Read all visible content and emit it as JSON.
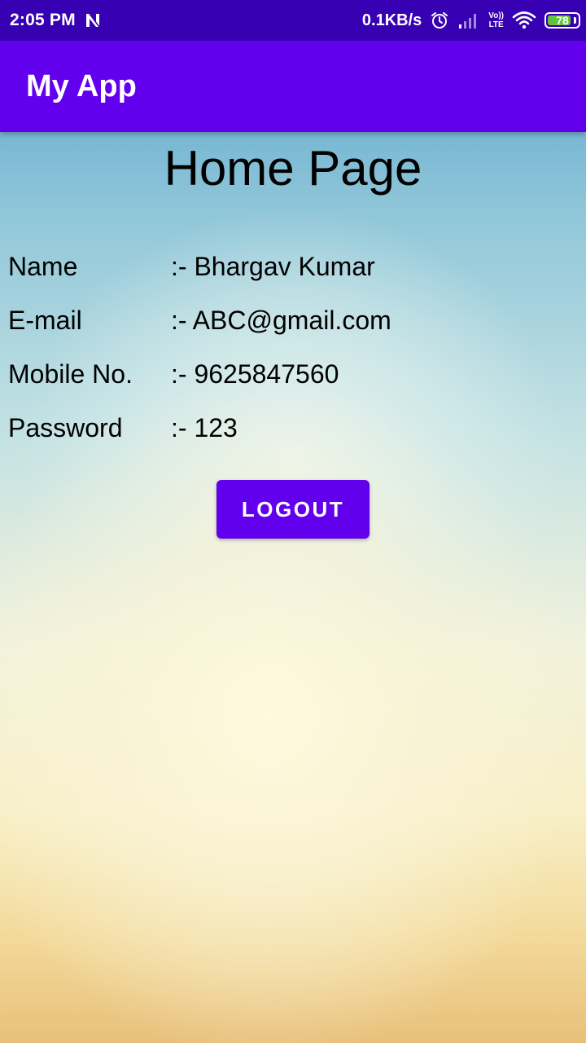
{
  "status_bar": {
    "time": "2:05 PM",
    "notification_icon": "n-app-icon",
    "net_speed": "0.1KB/s",
    "alarm_icon": "alarm-icon",
    "signal_icon": "signal-icon",
    "volte_top": "Vo))",
    "volte_bottom": "LTE",
    "wifi_icon": "wifi-icon",
    "battery_level": "78",
    "battery_fraction": 0.78,
    "battery_color": "#63c43a"
  },
  "app_bar": {
    "title": "My App",
    "color": "#6200ee"
  },
  "page": {
    "title": "Home Page"
  },
  "details": [
    {
      "label": "Name",
      "value": ":- Bhargav Kumar"
    },
    {
      "label": "E-mail",
      "value": ":- ABC@gmail.com"
    },
    {
      "label": "Mobile No.",
      "value": ":- 9625847560"
    },
    {
      "label": "Password",
      "value": ":- 123"
    }
  ],
  "logout_button": {
    "label": "LOGOUT",
    "color": "#6200ee"
  }
}
